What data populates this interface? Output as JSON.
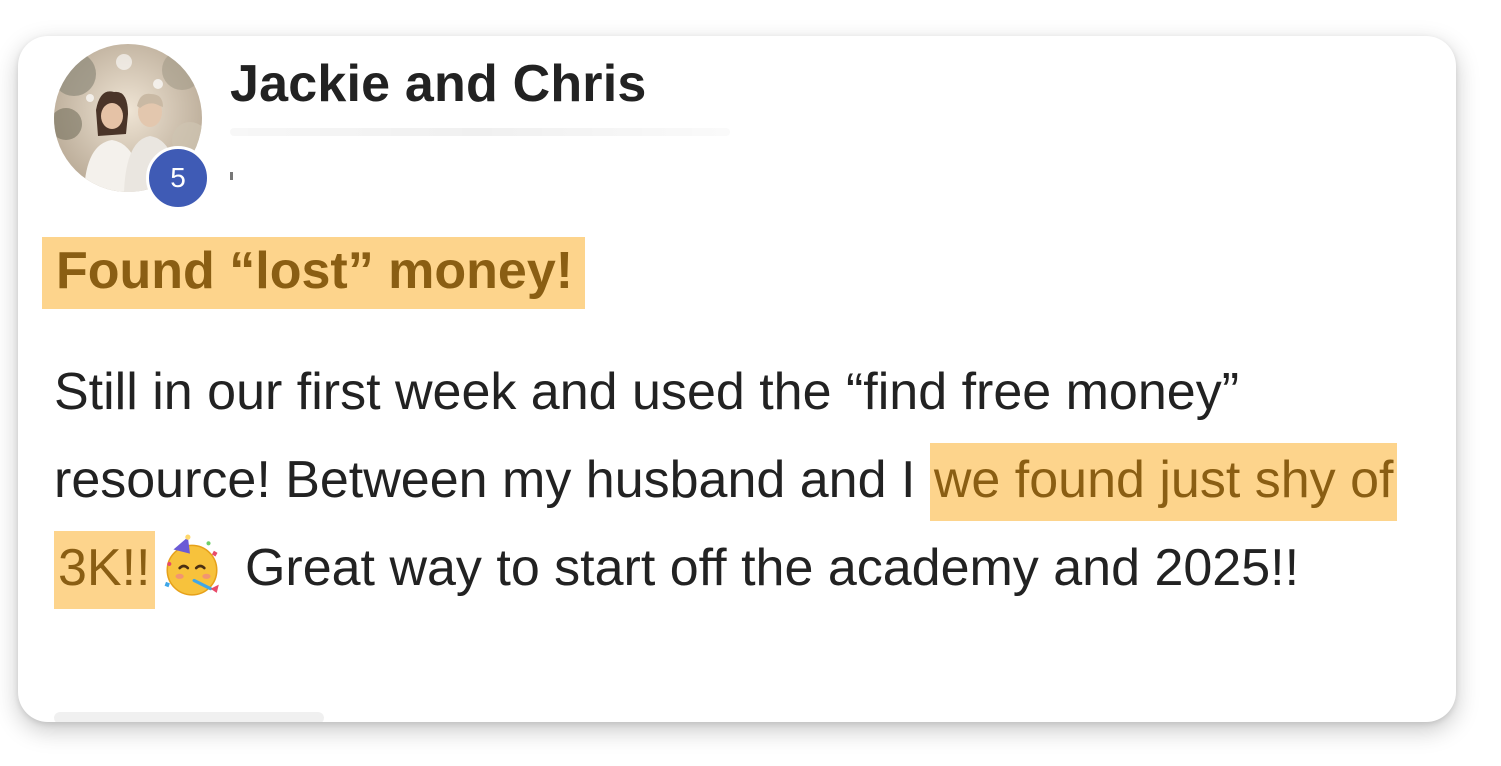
{
  "post": {
    "author": {
      "name": "Jackie and Chris",
      "level": "5"
    },
    "title": "Found “lost” money!",
    "body": {
      "part1": "Still in our first week and used the “find free money” resource! Between my husband and I ",
      "highlight": "we found just shy of 3K!!",
      "part2": " Great way to start off the academy and 2025!!"
    }
  },
  "colors": {
    "highlight_bg": "#fdd48c",
    "highlight_text": "#8a5e13",
    "level_badge": "#3f5bb5"
  },
  "icons": {
    "emoji": "partying-face-icon"
  }
}
